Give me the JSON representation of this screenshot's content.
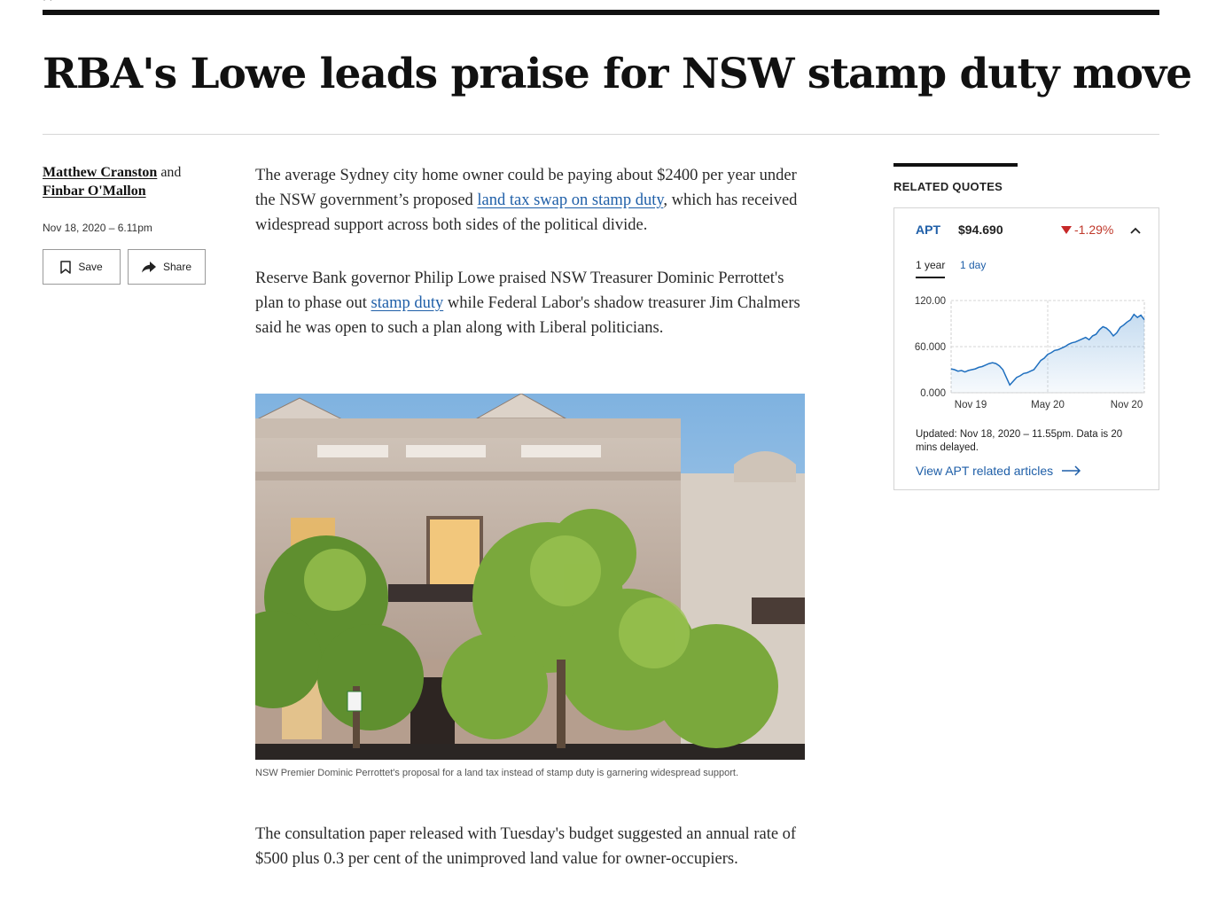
{
  "header": {
    "breadcrumb_fragment": "· ·",
    "headline": "RBA's Lowe leads praise for NSW stamp duty move"
  },
  "byline": {
    "author1": "Matthew Cranston",
    "connector": "and",
    "author2": "Finbar O'Mallon",
    "date": "Nov 18, 2020 – 6.11pm"
  },
  "actions": {
    "save_label": "Save",
    "share_label": "Share",
    "save_icon": "bookmark-icon",
    "share_icon": "share-arrow-icon"
  },
  "article": {
    "p1_before": "The average Sydney city home owner could be paying about $2400 per year under the NSW government’s proposed ",
    "p1_link": "land tax swap on stamp duty",
    "p1_after": ", which has received widespread support across both sides of the political divide.",
    "p2_before": "Reserve Bank governor Philip Lowe praised NSW Treasurer Dominic Perrottet's plan to phase out ",
    "p2_link": "stamp duty",
    "p2_after": " while Federal Labor's shadow treasurer Jim Chalmers said he was open to such a plan along with Liberal politicians.",
    "image_caption": "NSW Premier Dominic Perrottet's proposal for a land tax instead of stamp duty is garnering widespread support.",
    "p3": "The consultation paper released with Tuesday's budget suggested an annual rate of $500 plus 0.3 per cent of the unimproved land value for owner-occupiers."
  },
  "related_quotes": {
    "title": "RELATED QUOTES",
    "ticker": "APT",
    "price": "$94.690",
    "change": "-1.29%",
    "change_direction": "down",
    "change_color": "#c62828",
    "tabs": [
      "1 year",
      "1 day"
    ],
    "active_tab": "1 year",
    "updated": "Updated: Nov 18, 2020 – 11.55pm. Data is 20 mins delayed.",
    "link_label": "View APT related articles",
    "accent_color": "#1f5fa8"
  },
  "chart_data": {
    "type": "area",
    "title": "",
    "xlabel": "",
    "ylabel": "",
    "y_tick_labels": [
      "120.00",
      "60.000",
      "0.000"
    ],
    "y_ticks": [
      120,
      60,
      0
    ],
    "x_tick_labels": [
      "Nov 19",
      "May 20",
      "Nov 20"
    ],
    "ylim": [
      0,
      120
    ],
    "grid": true,
    "series": [
      {
        "values": [
          31,
          30,
          28,
          29,
          27,
          29,
          30,
          31,
          33,
          34,
          36,
          38,
          39,
          38,
          35,
          30,
          20,
          10,
          15,
          20,
          22,
          25,
          26,
          28,
          30,
          36,
          42,
          45,
          50,
          52,
          55,
          56,
          58,
          60,
          63,
          65,
          66,
          68,
          70,
          72,
          69,
          74,
          76,
          82,
          86,
          84,
          80,
          74,
          78,
          85,
          88,
          92,
          95,
          102,
          98,
          101,
          95
        ]
      }
    ]
  }
}
